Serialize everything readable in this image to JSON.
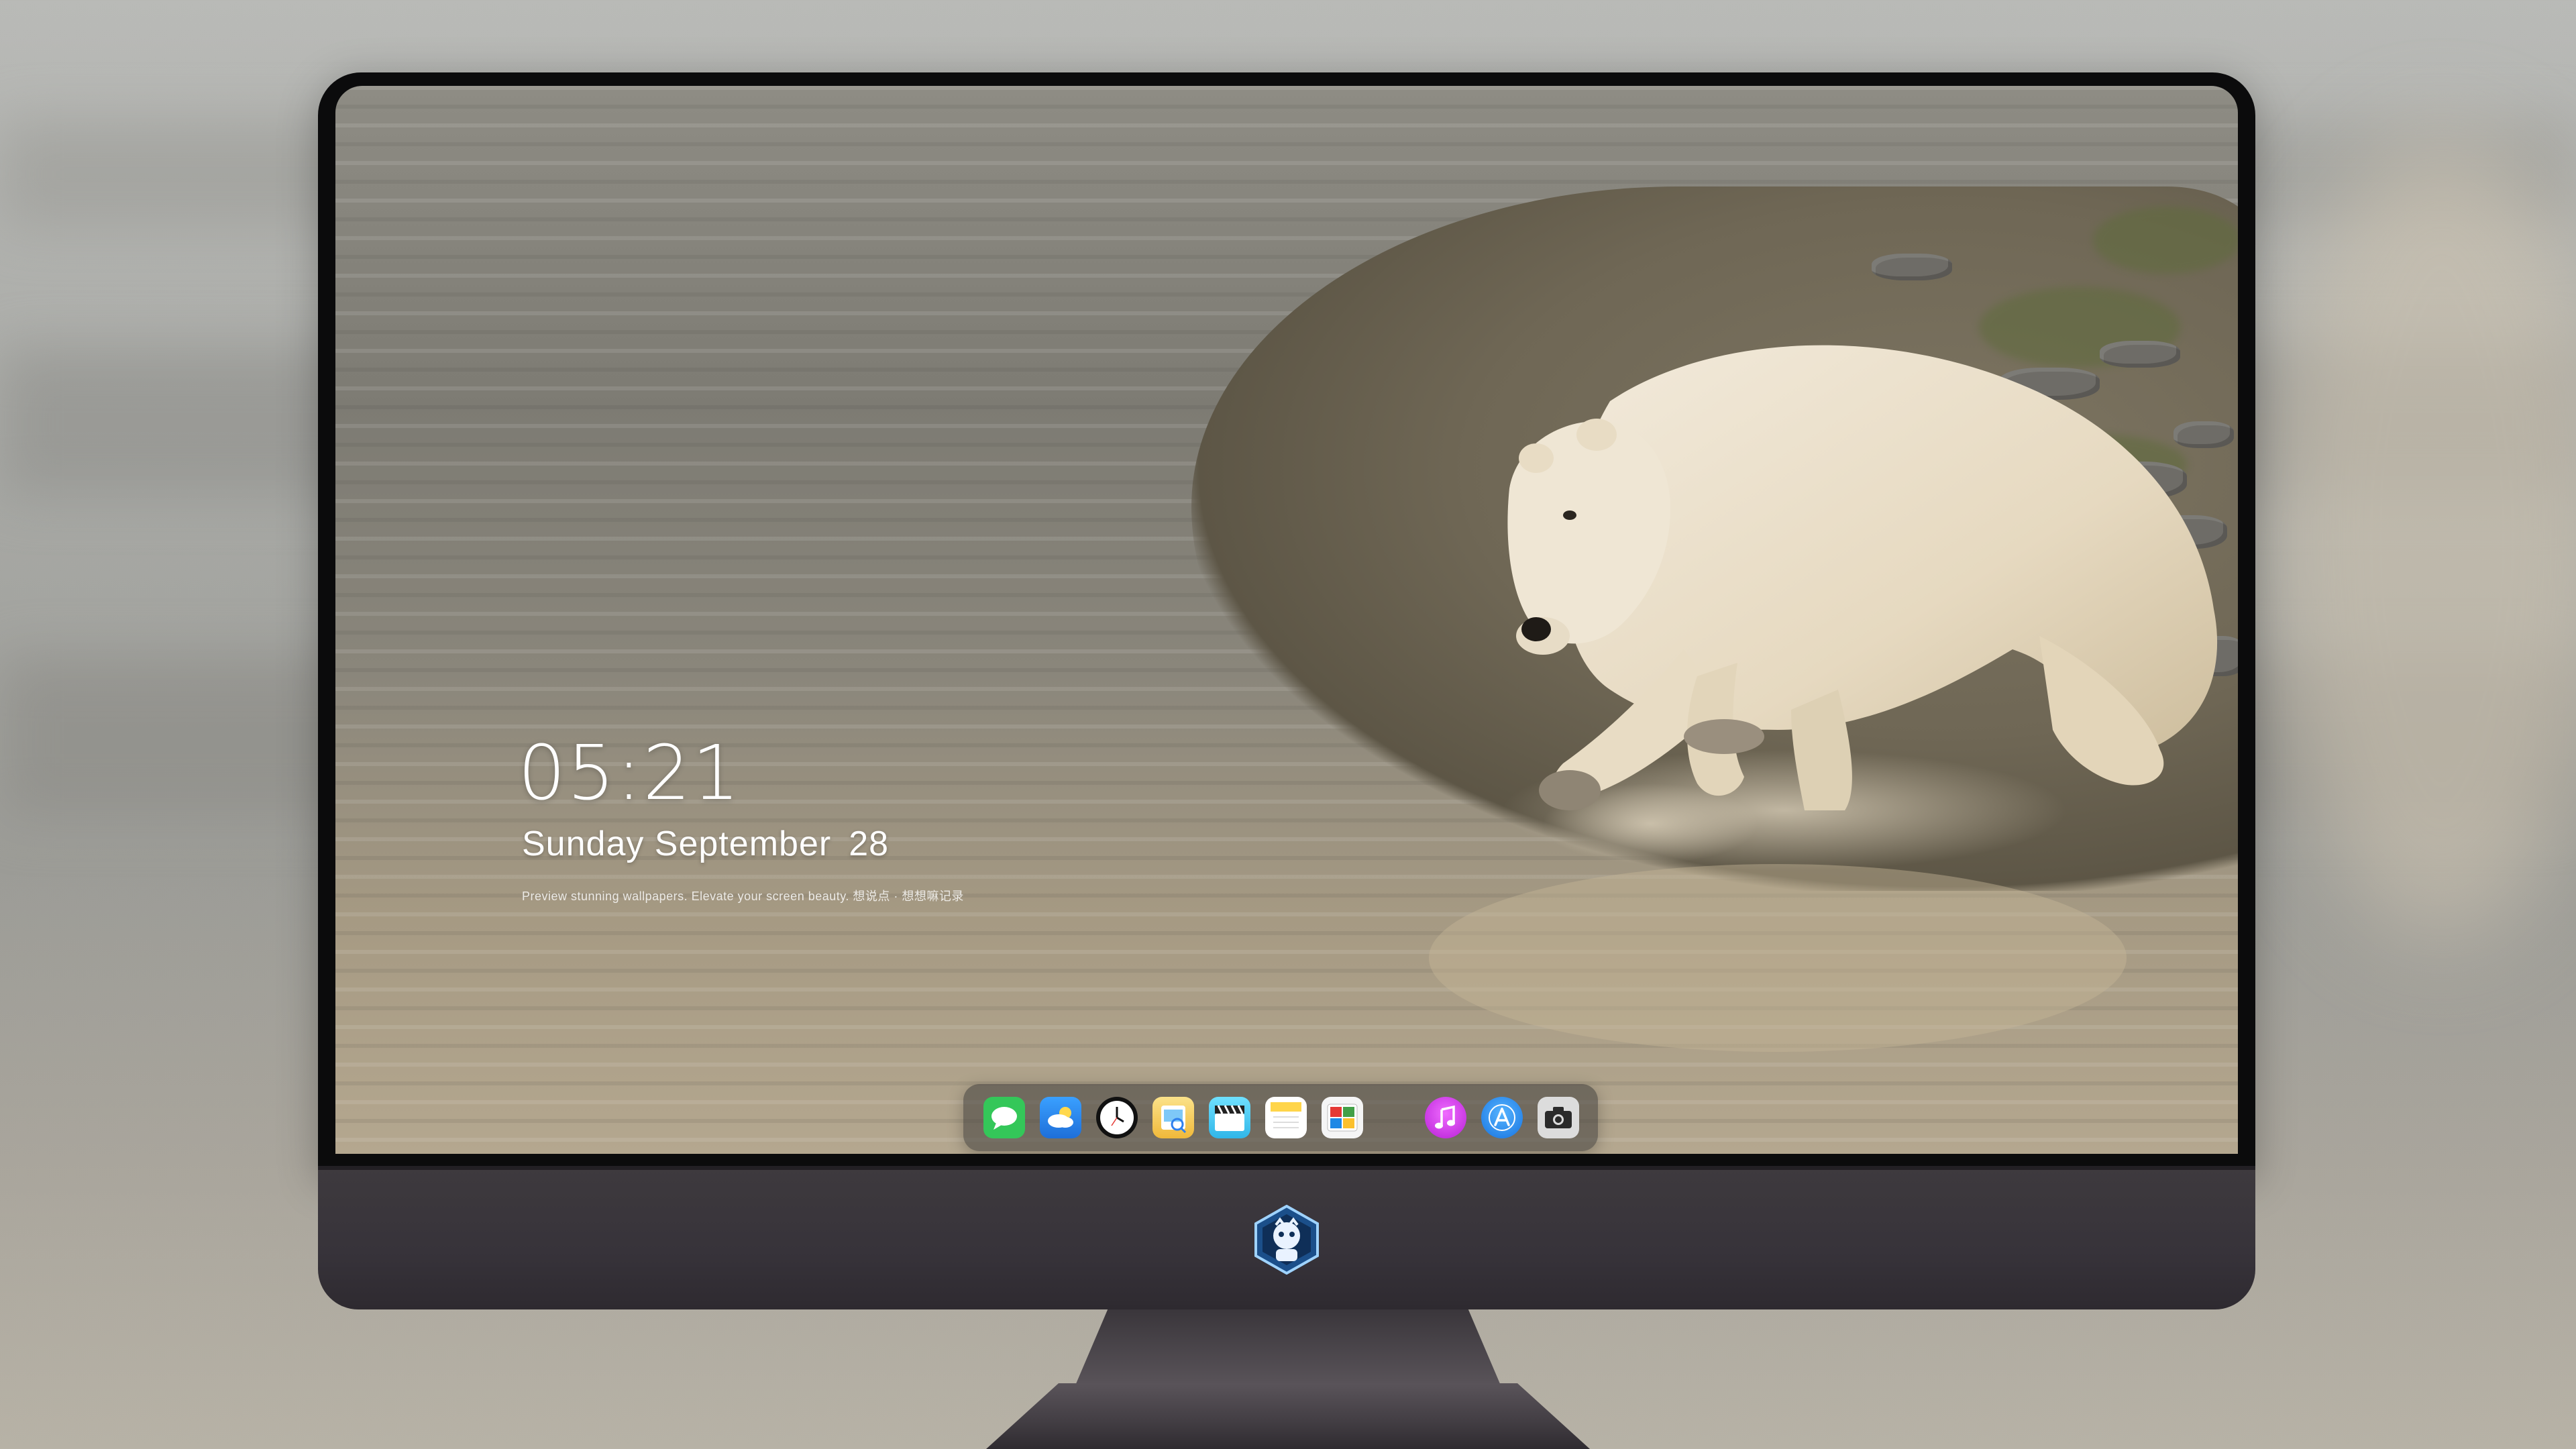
{
  "lockscreen": {
    "time": "05:21",
    "weekday_month": "Sunday September",
    "day_number": "28",
    "tagline": "Preview stunning wallpapers. Elevate your screen beauty. 想说点 · 想想嘛记录"
  },
  "dock": {
    "items": [
      {
        "name": "messages",
        "icon": "chat-bubble-icon",
        "color": "#34c759"
      },
      {
        "name": "weather",
        "icon": "weather-icon",
        "color": "#2f80ed"
      },
      {
        "name": "clock",
        "icon": "clock-icon",
        "color": "#111111"
      },
      {
        "name": "preview",
        "icon": "preview-icon",
        "color": "#f2c94c"
      },
      {
        "name": "clips",
        "icon": "clapperboard-icon",
        "color": "#56ccf2"
      },
      {
        "name": "notes",
        "icon": "notes-icon",
        "color": "#ffd54a"
      },
      {
        "name": "photo-booth",
        "icon": "photo-booth-icon",
        "color": "#ffffff"
      },
      {
        "name": "music",
        "icon": "music-note-icon",
        "color": "#e040fb"
      },
      {
        "name": "app-store",
        "icon": "app-store-icon",
        "color": "#1e90ff"
      },
      {
        "name": "camera",
        "icon": "camera-icon",
        "color": "#2b2b2b"
      }
    ]
  },
  "colors": {
    "bezel": "#0b0b0c",
    "chin": "#3a363b",
    "accent_blue": "#1e90ff"
  }
}
